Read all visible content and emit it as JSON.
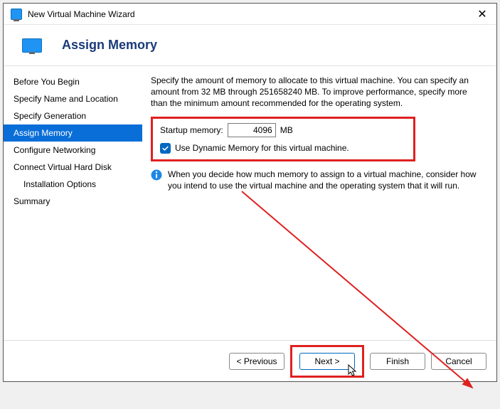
{
  "window": {
    "title": "New Virtual Machine Wizard"
  },
  "header": {
    "title": "Assign Memory"
  },
  "sidebar": {
    "items": [
      {
        "label": "Before You Begin"
      },
      {
        "label": "Specify Name and Location"
      },
      {
        "label": "Specify Generation"
      },
      {
        "label": "Assign Memory"
      },
      {
        "label": "Configure Networking"
      },
      {
        "label": "Connect Virtual Hard Disk"
      },
      {
        "label": "Installation Options"
      },
      {
        "label": "Summary"
      }
    ]
  },
  "content": {
    "intro": "Specify the amount of memory to allocate to this virtual machine. You can specify an amount from 32 MB through 251658240 MB. To improve performance, specify more than the minimum amount recommended for the operating system.",
    "startup_label": "Startup memory:",
    "startup_value": "4096",
    "startup_unit": "MB",
    "dynamic_label": "Use Dynamic Memory for this virtual machine.",
    "info": "When you decide how much memory to assign to a virtual machine, consider how you intend to use the virtual machine and the operating system that it will run."
  },
  "footer": {
    "previous": "< Previous",
    "next": "Next >",
    "finish": "Finish",
    "cancel": "Cancel"
  }
}
